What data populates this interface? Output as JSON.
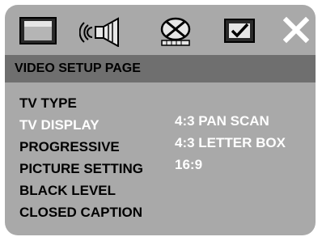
{
  "toolbar": {
    "icons": [
      {
        "name": "general-setup-icon"
      },
      {
        "name": "audio-setup-icon"
      },
      {
        "name": "video-setup-icon"
      },
      {
        "name": "preference-setup-icon"
      },
      {
        "name": "exit-icon"
      }
    ]
  },
  "header": {
    "title": "VIDEO SETUP PAGE"
  },
  "menu": {
    "items": [
      {
        "label": "TV TYPE"
      },
      {
        "label": "TV DISPLAY"
      },
      {
        "label": "PROGRESSIVE"
      },
      {
        "label": "PICTURE SETTING"
      },
      {
        "label": "BLACK LEVEL"
      },
      {
        "label": "CLOSED CAPTION"
      }
    ],
    "active_index": 1
  },
  "options": {
    "items": [
      {
        "label": "4:3 PAN SCAN"
      },
      {
        "label": "4:3 LETTER BOX"
      },
      {
        "label": "16:9"
      }
    ]
  },
  "colors": {
    "panel": "#a9a9a9",
    "header": "#6f6f6f",
    "active_text": "#ffffff"
  }
}
